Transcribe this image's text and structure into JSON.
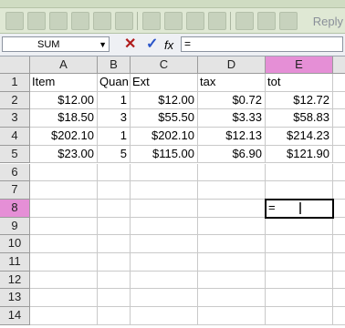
{
  "toolbar": {
    "reply_label": "Reply"
  },
  "formula_bar": {
    "name_box": "SUM",
    "cancel_glyph": "✕",
    "enter_glyph": "✓",
    "fx_label": "fx",
    "content": "="
  },
  "columns": [
    "A",
    "B",
    "C",
    "D",
    "E"
  ],
  "rows": [
    "1",
    "2",
    "3",
    "4",
    "5",
    "6",
    "7",
    "8",
    "9",
    "10",
    "11",
    "12",
    "13",
    "14"
  ],
  "headers": {
    "a": "Item",
    "b": "Quan",
    "c": "Ext",
    "d": "tax",
    "e": "tot"
  },
  "data_rows": [
    {
      "a": "$12.00",
      "b": "1",
      "c": "$12.00",
      "d": "$0.72",
      "e": "$12.72"
    },
    {
      "a": "$18.50",
      "b": "3",
      "c": "$55.50",
      "d": "$3.33",
      "e": "$58.83"
    },
    {
      "a": "$202.10",
      "b": "1",
      "c": "$202.10",
      "d": "$12.13",
      "e": "$214.23"
    },
    {
      "a": "$23.00",
      "b": "5",
      "c": "$115.00",
      "d": "$6.90",
      "e": "$121.90"
    }
  ],
  "active_cell": {
    "ref": "E8",
    "content": "="
  },
  "colors": {
    "selected_header": "#e58fd6",
    "toolbar": "#dfe8d4"
  }
}
